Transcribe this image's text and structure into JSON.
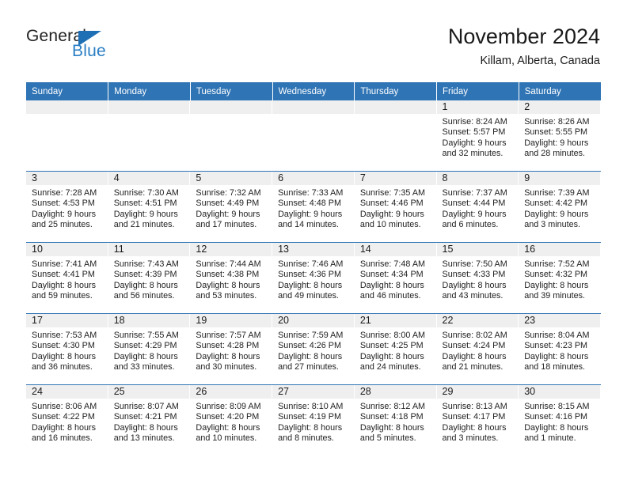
{
  "logo": {
    "word_general": "General",
    "word_blue": "Blue",
    "triangle_color": "#1f6fb5",
    "blue_text_color": "#2a7ec4"
  },
  "header": {
    "title": "November 2024",
    "subtitle": "Killam, Alberta, Canada",
    "accent_color": "#2f74b5",
    "band_color": "#efefef"
  },
  "weekday_headers": [
    "Sunday",
    "Monday",
    "Tuesday",
    "Wednesday",
    "Thursday",
    "Friday",
    "Saturday"
  ],
  "weeks": [
    [
      {
        "day": "",
        "lines": []
      },
      {
        "day": "",
        "lines": []
      },
      {
        "day": "",
        "lines": []
      },
      {
        "day": "",
        "lines": []
      },
      {
        "day": "",
        "lines": []
      },
      {
        "day": "1",
        "lines": [
          "Sunrise: 8:24 AM",
          "Sunset: 5:57 PM",
          "Daylight: 9 hours",
          "and 32 minutes."
        ]
      },
      {
        "day": "2",
        "lines": [
          "Sunrise: 8:26 AM",
          "Sunset: 5:55 PM",
          "Daylight: 9 hours",
          "and 28 minutes."
        ]
      }
    ],
    [
      {
        "day": "3",
        "lines": [
          "Sunrise: 7:28 AM",
          "Sunset: 4:53 PM",
          "Daylight: 9 hours",
          "and 25 minutes."
        ]
      },
      {
        "day": "4",
        "lines": [
          "Sunrise: 7:30 AM",
          "Sunset: 4:51 PM",
          "Daylight: 9 hours",
          "and 21 minutes."
        ]
      },
      {
        "day": "5",
        "lines": [
          "Sunrise: 7:32 AM",
          "Sunset: 4:49 PM",
          "Daylight: 9 hours",
          "and 17 minutes."
        ]
      },
      {
        "day": "6",
        "lines": [
          "Sunrise: 7:33 AM",
          "Sunset: 4:48 PM",
          "Daylight: 9 hours",
          "and 14 minutes."
        ]
      },
      {
        "day": "7",
        "lines": [
          "Sunrise: 7:35 AM",
          "Sunset: 4:46 PM",
          "Daylight: 9 hours",
          "and 10 minutes."
        ]
      },
      {
        "day": "8",
        "lines": [
          "Sunrise: 7:37 AM",
          "Sunset: 4:44 PM",
          "Daylight: 9 hours",
          "and 6 minutes."
        ]
      },
      {
        "day": "9",
        "lines": [
          "Sunrise: 7:39 AM",
          "Sunset: 4:42 PM",
          "Daylight: 9 hours",
          "and 3 minutes."
        ]
      }
    ],
    [
      {
        "day": "10",
        "lines": [
          "Sunrise: 7:41 AM",
          "Sunset: 4:41 PM",
          "Daylight: 8 hours",
          "and 59 minutes."
        ]
      },
      {
        "day": "11",
        "lines": [
          "Sunrise: 7:43 AM",
          "Sunset: 4:39 PM",
          "Daylight: 8 hours",
          "and 56 minutes."
        ]
      },
      {
        "day": "12",
        "lines": [
          "Sunrise: 7:44 AM",
          "Sunset: 4:38 PM",
          "Daylight: 8 hours",
          "and 53 minutes."
        ]
      },
      {
        "day": "13",
        "lines": [
          "Sunrise: 7:46 AM",
          "Sunset: 4:36 PM",
          "Daylight: 8 hours",
          "and 49 minutes."
        ]
      },
      {
        "day": "14",
        "lines": [
          "Sunrise: 7:48 AM",
          "Sunset: 4:34 PM",
          "Daylight: 8 hours",
          "and 46 minutes."
        ]
      },
      {
        "day": "15",
        "lines": [
          "Sunrise: 7:50 AM",
          "Sunset: 4:33 PM",
          "Daylight: 8 hours",
          "and 43 minutes."
        ]
      },
      {
        "day": "16",
        "lines": [
          "Sunrise: 7:52 AM",
          "Sunset: 4:32 PM",
          "Daylight: 8 hours",
          "and 39 minutes."
        ]
      }
    ],
    [
      {
        "day": "17",
        "lines": [
          "Sunrise: 7:53 AM",
          "Sunset: 4:30 PM",
          "Daylight: 8 hours",
          "and 36 minutes."
        ]
      },
      {
        "day": "18",
        "lines": [
          "Sunrise: 7:55 AM",
          "Sunset: 4:29 PM",
          "Daylight: 8 hours",
          "and 33 minutes."
        ]
      },
      {
        "day": "19",
        "lines": [
          "Sunrise: 7:57 AM",
          "Sunset: 4:28 PM",
          "Daylight: 8 hours",
          "and 30 minutes."
        ]
      },
      {
        "day": "20",
        "lines": [
          "Sunrise: 7:59 AM",
          "Sunset: 4:26 PM",
          "Daylight: 8 hours",
          "and 27 minutes."
        ]
      },
      {
        "day": "21",
        "lines": [
          "Sunrise: 8:00 AM",
          "Sunset: 4:25 PM",
          "Daylight: 8 hours",
          "and 24 minutes."
        ]
      },
      {
        "day": "22",
        "lines": [
          "Sunrise: 8:02 AM",
          "Sunset: 4:24 PM",
          "Daylight: 8 hours",
          "and 21 minutes."
        ]
      },
      {
        "day": "23",
        "lines": [
          "Sunrise: 8:04 AM",
          "Sunset: 4:23 PM",
          "Daylight: 8 hours",
          "and 18 minutes."
        ]
      }
    ],
    [
      {
        "day": "24",
        "lines": [
          "Sunrise: 8:06 AM",
          "Sunset: 4:22 PM",
          "Daylight: 8 hours",
          "and 16 minutes."
        ]
      },
      {
        "day": "25",
        "lines": [
          "Sunrise: 8:07 AM",
          "Sunset: 4:21 PM",
          "Daylight: 8 hours",
          "and 13 minutes."
        ]
      },
      {
        "day": "26",
        "lines": [
          "Sunrise: 8:09 AM",
          "Sunset: 4:20 PM",
          "Daylight: 8 hours",
          "and 10 minutes."
        ]
      },
      {
        "day": "27",
        "lines": [
          "Sunrise: 8:10 AM",
          "Sunset: 4:19 PM",
          "Daylight: 8 hours",
          "and 8 minutes."
        ]
      },
      {
        "day": "28",
        "lines": [
          "Sunrise: 8:12 AM",
          "Sunset: 4:18 PM",
          "Daylight: 8 hours",
          "and 5 minutes."
        ]
      },
      {
        "day": "29",
        "lines": [
          "Sunrise: 8:13 AM",
          "Sunset: 4:17 PM",
          "Daylight: 8 hours",
          "and 3 minutes."
        ]
      },
      {
        "day": "30",
        "lines": [
          "Sunrise: 8:15 AM",
          "Sunset: 4:16 PM",
          "Daylight: 8 hours",
          "and 1 minute."
        ]
      }
    ]
  ]
}
